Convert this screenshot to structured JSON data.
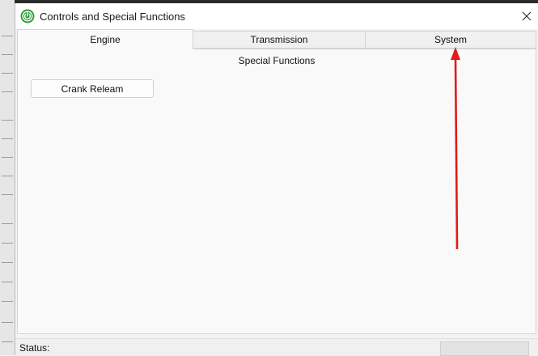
{
  "window": {
    "title": "Controls and Special Functions",
    "close_glyph": "✕"
  },
  "tabs": [
    {
      "label": "Engine",
      "active": true
    },
    {
      "label": "Transmission",
      "active": false
    },
    {
      "label": "System",
      "active": false
    }
  ],
  "panel": {
    "title": "Special Functions",
    "button_label": "Crank Releam"
  },
  "status": {
    "label": "Status:"
  },
  "colors": {
    "icon_green": "#2e9e3a",
    "annotation_arrow": "#e01b1b"
  },
  "icons": {
    "app": "power-icon",
    "close": "close-icon"
  }
}
